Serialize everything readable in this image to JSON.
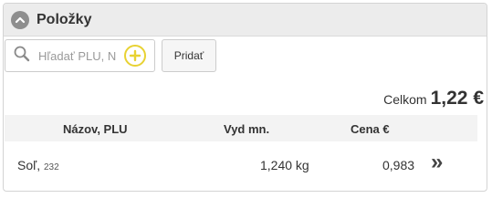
{
  "panel": {
    "title": "Položky"
  },
  "search": {
    "placeholder": "Hľadať PLU, N"
  },
  "toolbar": {
    "add_label": "Pridať"
  },
  "total": {
    "label": "Celkom",
    "value": "1,22 €"
  },
  "table": {
    "columns": [
      "Názov, PLU",
      "Vyd mn.",
      "Cena €"
    ],
    "rows": [
      {
        "name": "Soľ,",
        "plu": "232",
        "quantity": "1,240 kg",
        "price": "0,983",
        "action_icon": "»"
      }
    ]
  },
  "colors": {
    "header_bg": "#ececec",
    "accent_yellow": "#e8d233",
    "collapse_icon_bg": "#8e8e8e"
  }
}
